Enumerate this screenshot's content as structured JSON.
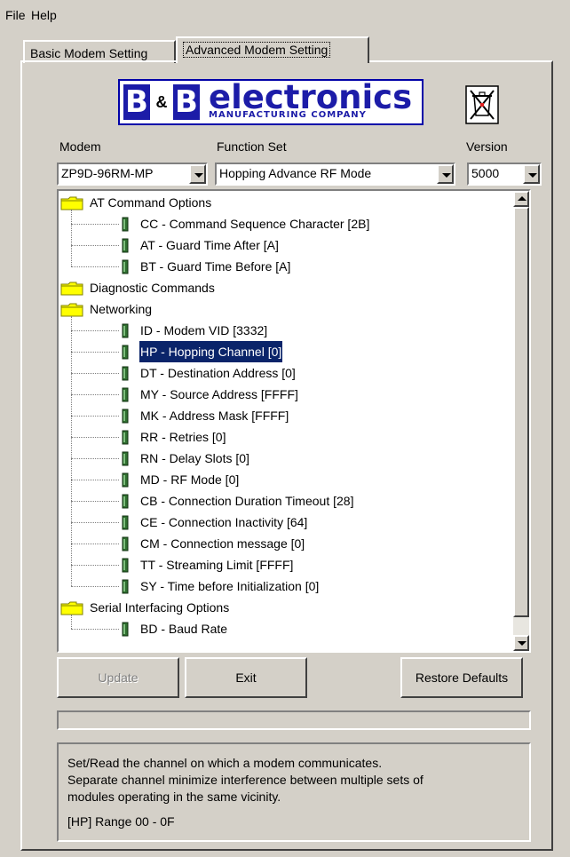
{
  "menu": {
    "file": "File",
    "help": "Help"
  },
  "tabs": [
    {
      "label": "Basic Modem Setting"
    },
    {
      "label": "Advanced Modem Setting"
    }
  ],
  "logo": {
    "bb_left": "B",
    "bb_amp": "&",
    "bb_right": "B",
    "brand": "electronics",
    "sub": "MANUFACTURING COMPANY"
  },
  "colors": {
    "selection": "#0a246a",
    "brand_blue": "#1c1ca8",
    "folder_yellow": "#ffff00"
  },
  "fields": {
    "modem": {
      "label": "Modem",
      "value": "ZP9D-96RM-MP"
    },
    "function_set": {
      "label": "Function Set",
      "value": "Hopping Advance RF Mode"
    },
    "version": {
      "label": "Version",
      "value": "5000"
    }
  },
  "tree": {
    "nodes": [
      {
        "type": "folder",
        "label": "AT Command Options"
      },
      {
        "type": "leaf",
        "label": "CC - Command Sequence Character [2B]"
      },
      {
        "type": "leaf",
        "label": "AT - Guard Time After [A]"
      },
      {
        "type": "leaf",
        "label": "BT - Guard Time Before [A]"
      },
      {
        "type": "folder",
        "label": "Diagnostic Commands"
      },
      {
        "type": "folder",
        "label": "Networking"
      },
      {
        "type": "leaf",
        "label": "ID - Modem VID [3332]"
      },
      {
        "type": "leaf",
        "label": "HP - Hopping Channel [0]",
        "selected": true
      },
      {
        "type": "leaf",
        "label": "DT - Destination Address [0]"
      },
      {
        "type": "leaf",
        "label": "MY - Source Address [FFFF]"
      },
      {
        "type": "leaf",
        "label": "MK - Address Mask [FFFF]"
      },
      {
        "type": "leaf",
        "label": "RR - Retries [0]"
      },
      {
        "type": "leaf",
        "label": "RN - Delay Slots [0]"
      },
      {
        "type": "leaf",
        "label": "MD - RF Mode [0]"
      },
      {
        "type": "leaf",
        "label": "CB - Connection Duration Timeout [28]"
      },
      {
        "type": "leaf",
        "label": "CE - Connection Inactivity [64]"
      },
      {
        "type": "leaf",
        "label": "CM - Connection message [0]"
      },
      {
        "type": "leaf",
        "label": "TT - Streaming Limit [FFFF]"
      },
      {
        "type": "leaf",
        "label": "SY - Time before Initialization [0]"
      },
      {
        "type": "folder",
        "label": "Serial Interfacing Options"
      },
      {
        "type": "leaf",
        "label": "BD - Baud Rate"
      }
    ]
  },
  "buttons": {
    "update": "Update",
    "exit": "Exit",
    "restore": "Restore Defaults"
  },
  "progress": {
    "fraction": 0
  },
  "description": {
    "lines": [
      "Set/Read the channel on which a modem communicates.",
      "Separate channel minimize interference between multiple sets of",
      "modules operating in the same vicinity."
    ],
    "range": "[HP] Range 00 - 0F"
  }
}
